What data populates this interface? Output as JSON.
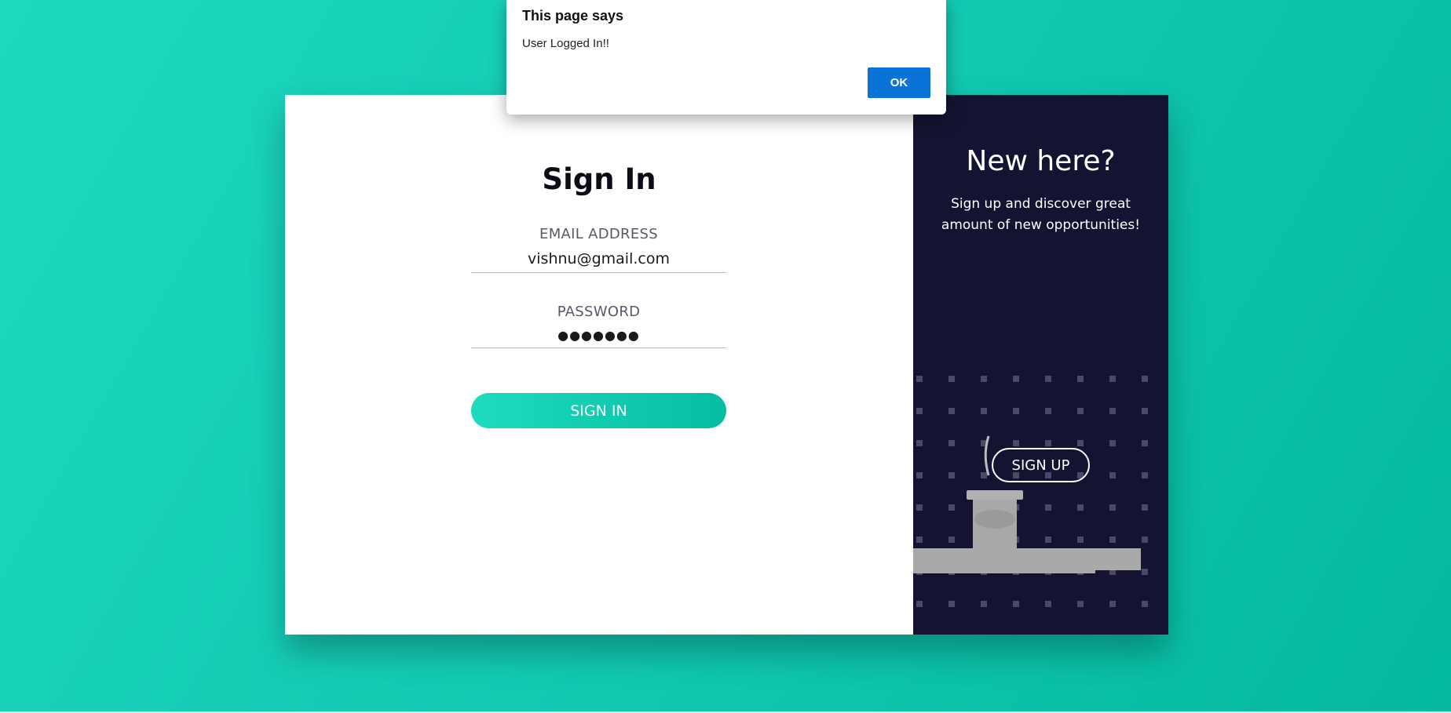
{
  "dialog": {
    "title": "This page says",
    "message": "User Logged In!!",
    "ok_label": "OK"
  },
  "signin": {
    "title": "Sign In",
    "email_label": "EMAIL ADDRESS",
    "email_value": "vishnu@gmail.com",
    "password_label": "PASSWORD",
    "password_value": "●●●●●●●",
    "button_label": "SIGN IN"
  },
  "signup": {
    "title": "New here?",
    "description": "Sign up and discover great amount of new opportunities!",
    "button_label": "SIGN UP"
  },
  "colors": {
    "background_start": "#1dd8bf",
    "background_end": "#04b99f",
    "panel_dark": "#141432",
    "dialog_button": "#0a73d8"
  }
}
